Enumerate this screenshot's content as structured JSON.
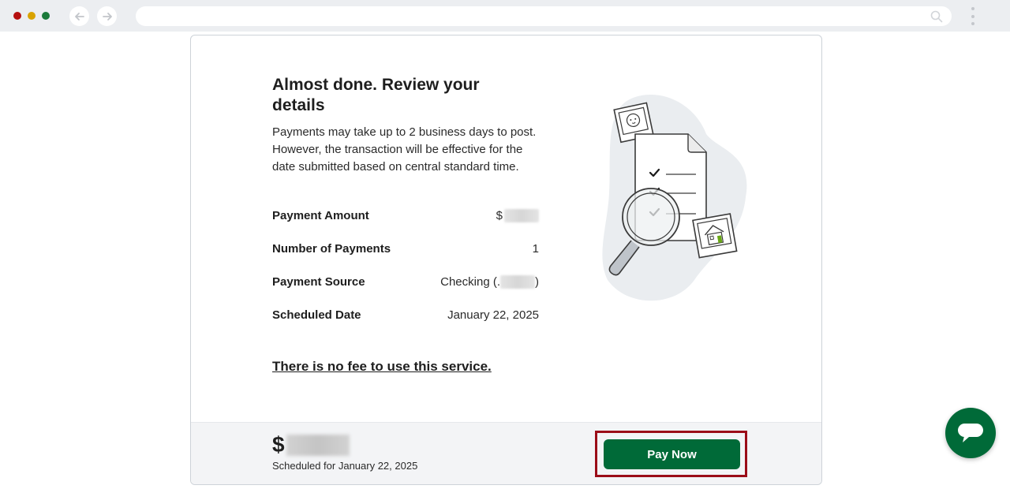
{
  "browser": {
    "back_icon": "arrow-left-icon",
    "forward_icon": "arrow-right-icon",
    "url": "",
    "search_icon": "search-icon",
    "menu_icon": "kebab-menu-icon"
  },
  "review": {
    "heading": "Almost done. Review your details",
    "intro": "Payments may take up to 2 business days to post. However, the transaction will be effective for the date submitted based on central standard time.",
    "rows": [
      {
        "label": "Payment Amount",
        "value_prefix": "$",
        "value_suffix": ""
      },
      {
        "label": "Number of Payments",
        "value_prefix": "1",
        "value_suffix": ""
      },
      {
        "label": "Payment Source",
        "value_prefix": "Checking (.",
        "value_suffix": ")"
      },
      {
        "label": "Scheduled Date",
        "value_prefix": "January 22, 2025",
        "value_suffix": ""
      }
    ],
    "fee_note": "There is no fee to use this service."
  },
  "footer": {
    "currency": "$",
    "scheduled": "Scheduled for January 22, 2025",
    "pay_button": "Pay Now"
  },
  "chat": {
    "icon": "chat-bubble-icon"
  },
  "colors": {
    "brand_green": "#006a38",
    "highlight_red": "#9b0d18",
    "accent_lime": "#6aa816"
  }
}
